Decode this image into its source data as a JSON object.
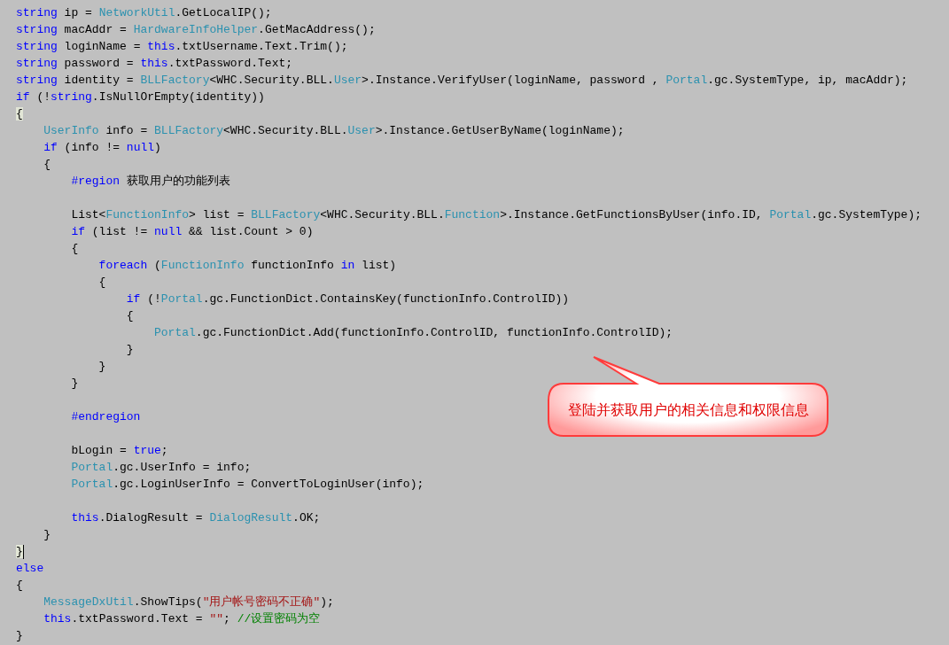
{
  "code_lines": [
    {
      "kind": "code",
      "tokens": [
        {
          "text": "string",
          "kind": "keyword"
        },
        {
          "text": " ip = ",
          "kind": "plain"
        },
        {
          "text": "NetworkUtil",
          "kind": "type"
        },
        {
          "text": ".GetLocalIP();",
          "kind": "plain"
        }
      ]
    },
    {
      "kind": "code",
      "tokens": [
        {
          "text": "string",
          "kind": "keyword"
        },
        {
          "text": " macAddr = ",
          "kind": "plain"
        },
        {
          "text": "HardwareInfoHelper",
          "kind": "type"
        },
        {
          "text": ".GetMacAddress();",
          "kind": "plain"
        }
      ]
    },
    {
      "kind": "code",
      "tokens": [
        {
          "text": "string",
          "kind": "keyword"
        },
        {
          "text": " loginName = ",
          "kind": "plain"
        },
        {
          "text": "this",
          "kind": "keyword"
        },
        {
          "text": ".txtUsername.Text.Trim();",
          "kind": "plain"
        }
      ]
    },
    {
      "kind": "code",
      "tokens": [
        {
          "text": "string",
          "kind": "keyword"
        },
        {
          "text": " password = ",
          "kind": "plain"
        },
        {
          "text": "this",
          "kind": "keyword"
        },
        {
          "text": ".txtPassword.Text;",
          "kind": "plain"
        }
      ]
    },
    {
      "kind": "code",
      "tokens": [
        {
          "text": "string",
          "kind": "keyword"
        },
        {
          "text": " identity = ",
          "kind": "plain"
        },
        {
          "text": "BLLFactory",
          "kind": "type"
        },
        {
          "text": "<WHC.Security.BLL.",
          "kind": "plain"
        },
        {
          "text": "User",
          "kind": "type"
        },
        {
          "text": ">.Instance.VerifyUser(loginName, password , ",
          "kind": "plain"
        },
        {
          "text": "Portal",
          "kind": "type"
        },
        {
          "text": ".gc.SystemType, ip, macAddr);",
          "kind": "plain"
        }
      ]
    },
    {
      "kind": "code",
      "tokens": [
        {
          "text": "if",
          "kind": "keyword"
        },
        {
          "text": " (!",
          "kind": "plain"
        },
        {
          "text": "string",
          "kind": "keyword"
        },
        {
          "text": ".IsNullOrEmpty(identity))",
          "kind": "plain"
        }
      ]
    },
    {
      "kind": "code",
      "tokens": [
        {
          "text": "{",
          "kind": "brace-match"
        }
      ],
      "children": [
        {
          "kind": "code",
          "tokens": [
            {
              "text": "UserInfo",
              "kind": "type"
            },
            {
              "text": " info = ",
              "kind": "plain"
            },
            {
              "text": "BLLFactory",
              "kind": "type"
            },
            {
              "text": "<WHC.Security.BLL.",
              "kind": "plain"
            },
            {
              "text": "User",
              "kind": "type"
            },
            {
              "text": ">.Instance.GetUserByName(loginName);",
              "kind": "plain"
            }
          ]
        },
        {
          "kind": "code",
          "tokens": [
            {
              "text": "if",
              "kind": "keyword"
            },
            {
              "text": " (info != ",
              "kind": "plain"
            },
            {
              "text": "null",
              "kind": "keyword"
            },
            {
              "text": ")",
              "kind": "plain"
            }
          ]
        },
        {
          "kind": "code",
          "tokens": [
            {
              "text": "{",
              "kind": "plain"
            }
          ],
          "children": [
            {
              "kind": "code",
              "tokens": [
                {
                  "text": "#region",
                  "kind": "keyword"
                },
                {
                  "text": " 获取用户的功能列表",
                  "kind": "plain"
                }
              ]
            },
            {
              "kind": "blank"
            },
            {
              "kind": "code",
              "tokens": [
                {
                  "text": "List<",
                  "kind": "plain"
                },
                {
                  "text": "FunctionInfo",
                  "kind": "type"
                },
                {
                  "text": "> list = ",
                  "kind": "plain"
                },
                {
                  "text": "BLLFactory",
                  "kind": "type"
                },
                {
                  "text": "<WHC.Security.BLL.",
                  "kind": "plain"
                },
                {
                  "text": "Function",
                  "kind": "type"
                },
                {
                  "text": ">.Instance.GetFunctionsByUser(info.ID, ",
                  "kind": "plain"
                },
                {
                  "text": "Portal",
                  "kind": "type"
                },
                {
                  "text": ".gc.SystemType);",
                  "kind": "plain"
                }
              ]
            },
            {
              "kind": "code",
              "tokens": [
                {
                  "text": "if",
                  "kind": "keyword"
                },
                {
                  "text": " (list != ",
                  "kind": "plain"
                },
                {
                  "text": "null",
                  "kind": "keyword"
                },
                {
                  "text": " && list.Count > 0)",
                  "kind": "plain"
                }
              ]
            },
            {
              "kind": "code",
              "tokens": [
                {
                  "text": "{",
                  "kind": "plain"
                }
              ],
              "children": [
                {
                  "kind": "code",
                  "tokens": [
                    {
                      "text": "foreach",
                      "kind": "keyword"
                    },
                    {
                      "text": " (",
                      "kind": "plain"
                    },
                    {
                      "text": "FunctionInfo",
                      "kind": "type"
                    },
                    {
                      "text": " functionInfo ",
                      "kind": "plain"
                    },
                    {
                      "text": "in",
                      "kind": "keyword"
                    },
                    {
                      "text": " list)",
                      "kind": "plain"
                    }
                  ]
                },
                {
                  "kind": "code",
                  "tokens": [
                    {
                      "text": "{",
                      "kind": "plain"
                    }
                  ],
                  "children": [
                    {
                      "kind": "code",
                      "tokens": [
                        {
                          "text": "if",
                          "kind": "keyword"
                        },
                        {
                          "text": " (!",
                          "kind": "plain"
                        },
                        {
                          "text": "Portal",
                          "kind": "type"
                        },
                        {
                          "text": ".gc.FunctionDict.ContainsKey(functionInfo.ControlID))",
                          "kind": "plain"
                        }
                      ]
                    },
                    {
                      "kind": "code",
                      "tokens": [
                        {
                          "text": "{",
                          "kind": "plain"
                        }
                      ],
                      "children": [
                        {
                          "kind": "code",
                          "tokens": [
                            {
                              "text": "Portal",
                              "kind": "type"
                            },
                            {
                              "text": ".gc.FunctionDict.Add(functionInfo.ControlID, functionInfo.ControlID);",
                              "kind": "plain"
                            }
                          ]
                        }
                      ]
                    },
                    {
                      "kind": "code",
                      "tokens": [
                        {
                          "text": "}",
                          "kind": "plain"
                        }
                      ]
                    }
                  ]
                },
                {
                  "kind": "code",
                  "tokens": [
                    {
                      "text": "}",
                      "kind": "plain"
                    }
                  ]
                }
              ]
            },
            {
              "kind": "code",
              "tokens": [
                {
                  "text": "}",
                  "kind": "plain"
                }
              ]
            },
            {
              "kind": "blank"
            },
            {
              "kind": "code",
              "tokens": [
                {
                  "text": "#endregion",
                  "kind": "keyword"
                }
              ]
            },
            {
              "kind": "blank"
            },
            {
              "kind": "code",
              "tokens": [
                {
                  "text": "bLogin = ",
                  "kind": "plain"
                },
                {
                  "text": "true",
                  "kind": "keyword"
                },
                {
                  "text": ";",
                  "kind": "plain"
                }
              ]
            },
            {
              "kind": "code",
              "tokens": [
                {
                  "text": "Portal",
                  "kind": "type"
                },
                {
                  "text": ".gc.UserInfo = info;",
                  "kind": "plain"
                }
              ]
            },
            {
              "kind": "code",
              "tokens": [
                {
                  "text": "Portal",
                  "kind": "type"
                },
                {
                  "text": ".gc.LoginUserInfo = ConvertToLoginUser(info);",
                  "kind": "plain"
                }
              ]
            },
            {
              "kind": "blank"
            },
            {
              "kind": "code",
              "tokens": [
                {
                  "text": "this",
                  "kind": "keyword"
                },
                {
                  "text": ".DialogResult = ",
                  "kind": "plain"
                },
                {
                  "text": "DialogResult",
                  "kind": "type"
                },
                {
                  "text": ".OK;",
                  "kind": "plain"
                }
              ]
            }
          ]
        },
        {
          "kind": "code",
          "tokens": [
            {
              "text": "}",
              "kind": "plain"
            }
          ]
        }
      ]
    },
    {
      "kind": "code",
      "caret": true,
      "tokens": [
        {
          "text": "}",
          "kind": "brace-match"
        }
      ]
    },
    {
      "kind": "code",
      "tokens": [
        {
          "text": "else",
          "kind": "keyword"
        }
      ]
    },
    {
      "kind": "code",
      "tokens": [
        {
          "text": "{",
          "kind": "plain"
        }
      ],
      "children": [
        {
          "kind": "code",
          "tokens": [
            {
              "text": "MessageDxUtil",
              "kind": "type"
            },
            {
              "text": ".ShowTips(",
              "kind": "plain"
            },
            {
              "text": "\"用户帐号密码不正确\"",
              "kind": "string"
            },
            {
              "text": ");",
              "kind": "plain"
            }
          ]
        },
        {
          "kind": "code",
          "tokens": [
            {
              "text": "this",
              "kind": "keyword"
            },
            {
              "text": ".txtPassword.Text = ",
              "kind": "plain"
            },
            {
              "text": "\"\"",
              "kind": "string"
            },
            {
              "text": "; ",
              "kind": "plain"
            },
            {
              "text": "//设置密码为空",
              "kind": "comment"
            }
          ]
        }
      ]
    },
    {
      "kind": "code",
      "tokens": [
        {
          "text": "}",
          "kind": "plain"
        }
      ]
    }
  ],
  "callout": {
    "text": "登陆并获取用户的相关信息和权限信息"
  }
}
